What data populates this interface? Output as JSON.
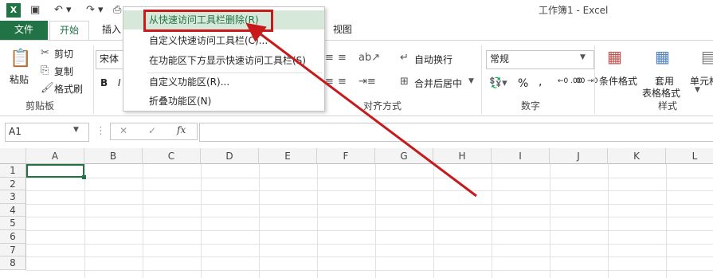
{
  "window": {
    "title": "工作簿1 - Excel",
    "app_icon": "excel-icon"
  },
  "tabs": {
    "file": "文件",
    "home": "开始",
    "insert": "插入",
    "view": "视图"
  },
  "context_menu": {
    "items": [
      {
        "label": "从快速访问工具栏删除(R)"
      },
      {
        "label": "自定义快速访问工具栏(C)..."
      },
      {
        "label": "在功能区下方显示快速访问工具栏(S)"
      },
      {
        "label": "自定义功能区(R)..."
      },
      {
        "label": "折叠功能区(N)"
      }
    ]
  },
  "ribbon": {
    "clipboard": {
      "paste": "粘贴",
      "cut": "剪切",
      "copy": "复制",
      "format_painter": "格式刷",
      "group": "剪贴板"
    },
    "font": {
      "name": "宋体",
      "bold": "B",
      "italic": "I"
    },
    "alignment": {
      "wrap_text": "自动换行",
      "merge_center": "合并后居中",
      "group": "对齐方式"
    },
    "number": {
      "format": "常规",
      "percent": "%",
      "comma": ",",
      "group": "数字",
      "inc_decimal": "←0 .00",
      "dec_decimal": ".00 →0"
    },
    "styles": {
      "conditional": "条件格式",
      "table_line1": "套用",
      "table_line2": "表格格式",
      "cell_styles": "单元格",
      "group": "样式"
    }
  },
  "formula_bar": {
    "name_box": "A1",
    "cancel": "✕",
    "enter": "✓",
    "fx": "fx",
    "value": ""
  },
  "sheet": {
    "columns": [
      "A",
      "B",
      "C",
      "D",
      "E",
      "F",
      "G",
      "H",
      "I",
      "J",
      "K",
      "L"
    ],
    "rows": [
      "1",
      "2",
      "3",
      "4",
      "5",
      "6",
      "7",
      "8"
    ],
    "active_cell": "A1"
  },
  "colors": {
    "accent": "#217346",
    "annotation": "#c81a1a"
  }
}
